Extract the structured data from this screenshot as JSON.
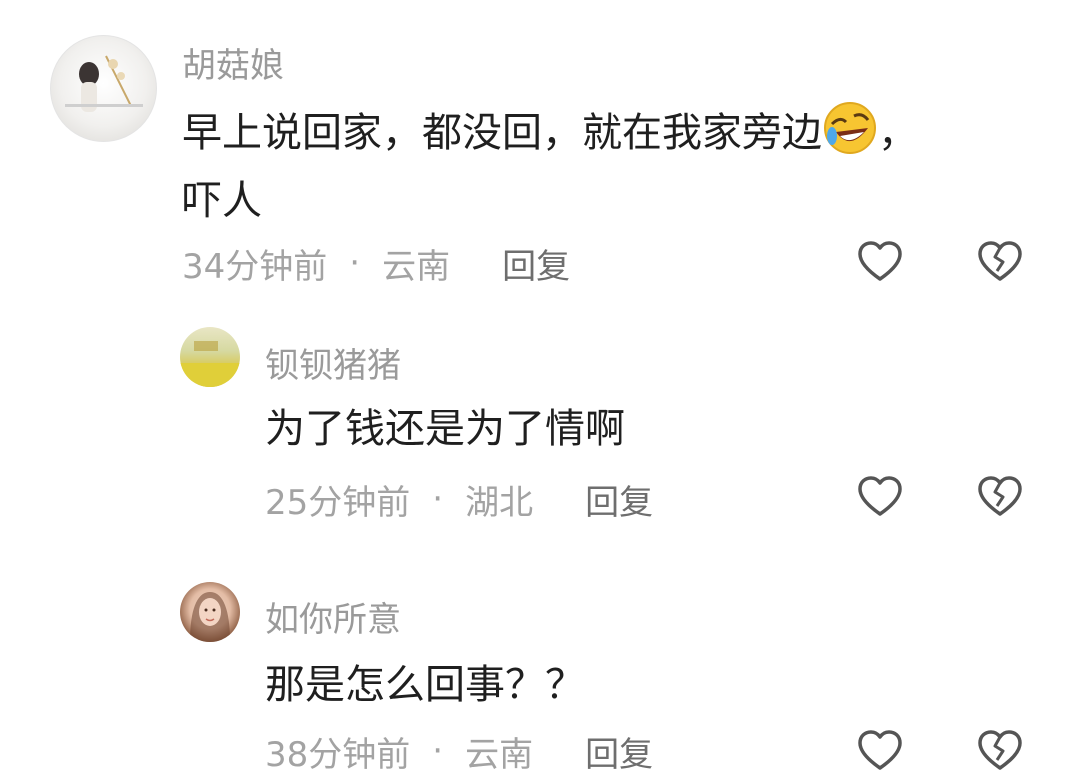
{
  "comments": [
    {
      "username": "胡菇娘",
      "text_part1": "早上说回家，都没回，就在我家旁边",
      "emoji_name": "rolling-on-floor-laughing",
      "text_part2": "，",
      "text_line2": "吓人",
      "time": "34分钟前",
      "separator": "·",
      "location": "云南",
      "reply_label": "回复"
    },
    {
      "username": "钡钡猪猪",
      "text": "为了钱还是为了情啊",
      "time": "25分钟前",
      "separator": "·",
      "location": "湖北",
      "reply_label": "回复"
    },
    {
      "username": "如你所意",
      "text": "那是怎么回事？？",
      "time": "38分钟前",
      "separator": "·",
      "location": "云南",
      "reply_label": "回复"
    }
  ],
  "icons": {
    "like": "heart-outline-icon",
    "dislike": "broken-heart-outline-icon"
  },
  "colors": {
    "text": "#1f1f1f",
    "username": "#9a9a9a",
    "meta": "#a3a3a3",
    "reply": "#6e6e6e",
    "icon": "#555555"
  }
}
